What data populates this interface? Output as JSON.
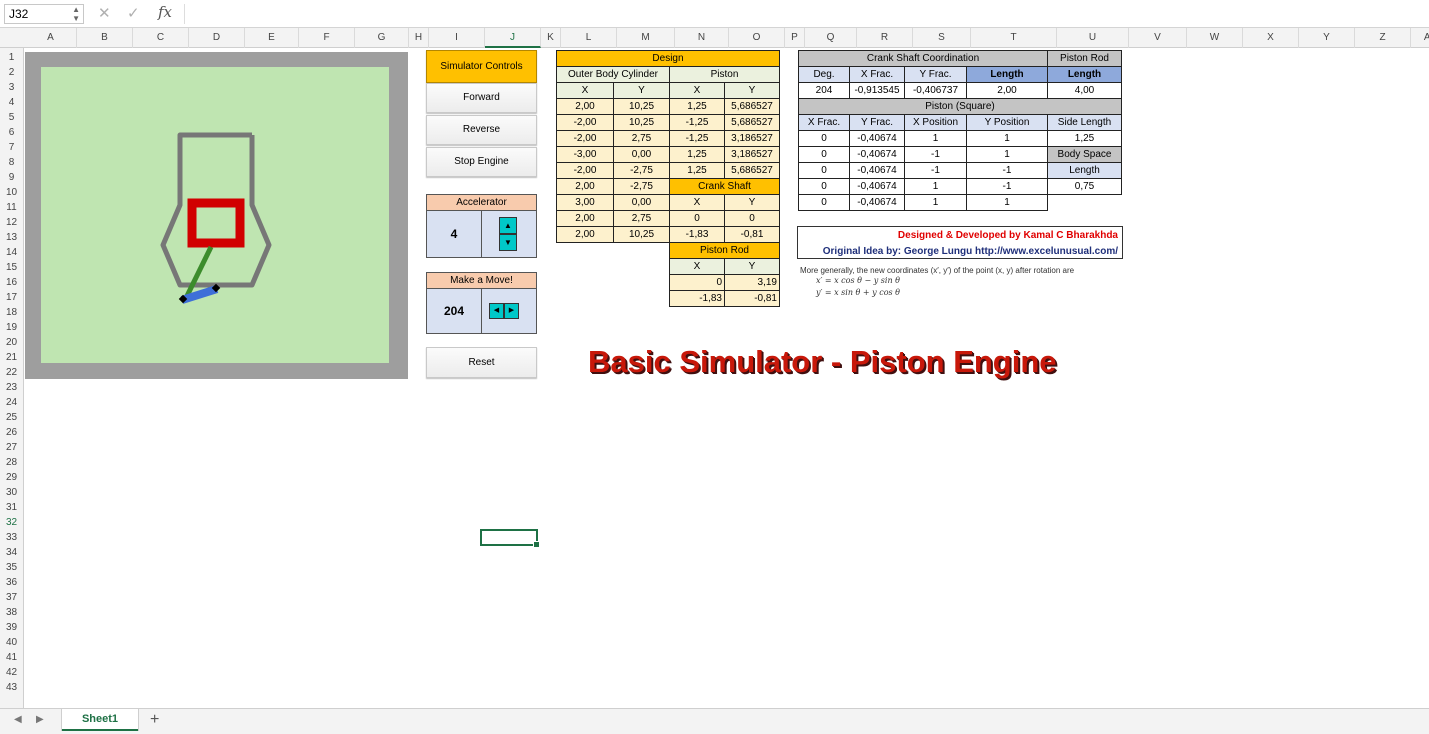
{
  "formula_bar": {
    "name_box": "J32",
    "cancel": "✕",
    "enter": "✓",
    "fx": "fx",
    "content": ""
  },
  "columns": [
    "A",
    "B",
    "C",
    "D",
    "E",
    "F",
    "G",
    "H",
    "I",
    "J",
    "K",
    "L",
    "M",
    "N",
    "O",
    "P",
    "Q",
    "R",
    "S",
    "T",
    "U",
    "V",
    "W",
    "X",
    "Y",
    "Z",
    "AA"
  ],
  "rows": [
    "1",
    "2",
    "3",
    "4",
    "5",
    "6",
    "7",
    "8",
    "9",
    "10",
    "11",
    "12",
    "13",
    "14",
    "15",
    "16",
    "17",
    "18",
    "19",
    "20",
    "21",
    "22",
    "23",
    "24",
    "25",
    "26",
    "27",
    "28",
    "29",
    "30",
    "31",
    "32",
    "33",
    "34",
    "35",
    "36",
    "37",
    "38",
    "39",
    "40",
    "41",
    "42",
    "43"
  ],
  "active_cell": {
    "column": "J",
    "row": "32"
  },
  "controls": {
    "title": "Simulator Controls",
    "forward": "Forward",
    "reverse": "Reverse",
    "stop": "Stop Engine",
    "accelerator_label": "Accelerator",
    "accelerator_value": "4",
    "move_label": "Make a Move!",
    "move_value": "204",
    "reset": "Reset"
  },
  "design_table": {
    "title": "Design",
    "outer_label": "Outer Body Cylinder",
    "piston_label": "Piston",
    "col_x": "X",
    "col_y": "Y",
    "outer_rows": [
      [
        "2,00",
        "10,25"
      ],
      [
        "-2,00",
        "10,25"
      ],
      [
        "-2,00",
        "2,75"
      ],
      [
        "-3,00",
        "0,00"
      ],
      [
        "-2,00",
        "-2,75"
      ],
      [
        "2,00",
        "-2,75"
      ],
      [
        "3,00",
        "0,00"
      ],
      [
        "2,00",
        "2,75"
      ],
      [
        "2,00",
        "10,25"
      ]
    ],
    "piston_rows": [
      [
        "1,25",
        "5,686527"
      ],
      [
        "-1,25",
        "5,686527"
      ],
      [
        "-1,25",
        "3,186527"
      ],
      [
        "1,25",
        "3,186527"
      ],
      [
        "1,25",
        "5,686527"
      ]
    ],
    "crank_label": "Crank Shaft",
    "crank_rows": [
      [
        "0",
        "0"
      ],
      [
        "-1,83",
        "-0,81"
      ]
    ],
    "rod_label": "Piston Rod",
    "rod_rows": [
      [
        "0",
        "3,19"
      ],
      [
        "-1,83",
        "-0,81"
      ]
    ]
  },
  "crank_table": {
    "title": "Crank Shaft Coordination",
    "headers": [
      "Deg.",
      "X Frac.",
      "Y Frac.",
      "Length"
    ],
    "values": [
      "204",
      "-0,913545",
      "-0,406737",
      "2,00"
    ],
    "rod_title": "Piston Rod",
    "rod_length_label": "Length",
    "rod_length_value": "4,00",
    "square_title": "Piston (Square)",
    "square_headers": [
      "X Frac.",
      "Y Frac.",
      "X Position",
      "Y Position"
    ],
    "square_rows": [
      [
        "0",
        "-0,40674",
        "1",
        "1"
      ],
      [
        "0",
        "-0,40674",
        "-1",
        "1"
      ],
      [
        "0",
        "-0,40674",
        "-1",
        "-1"
      ],
      [
        "0",
        "-0,40674",
        "1",
        "-1"
      ],
      [
        "0",
        "-0,40674",
        "1",
        "1"
      ]
    ],
    "side_length_label": "Side Length",
    "side_length_value": "1,25",
    "body_space_label": "Body Space",
    "body_length_label": "Length",
    "body_length_value": "0,75"
  },
  "credits": {
    "line1": "Designed & Developed by Kamal C Bharakhda",
    "line2": "Original Idea by: George Lungu http://www.excelunusual.com/"
  },
  "formula_note": {
    "text": "More generally, the new coordinates (x′, y′) of the point (x, y) after rotation are",
    "eq1": "x′ = x cos θ − y sin θ",
    "eq2": "y′ = x sin θ + y cos θ"
  },
  "big_title": "Basic Simulator - Piston Engine",
  "sheet_tab": "Sheet1",
  "add_tab": "+",
  "colors": {
    "accent": "#1e7145",
    "design_header": "#ffc000",
    "cell_yellow": "#fdf1cd",
    "title_red": "#c8180a",
    "spinner": "#00c8c8",
    "piston": "#d10000",
    "rod": "#3c8c2c",
    "crank": "#3e6fd8",
    "body": "#777777"
  }
}
